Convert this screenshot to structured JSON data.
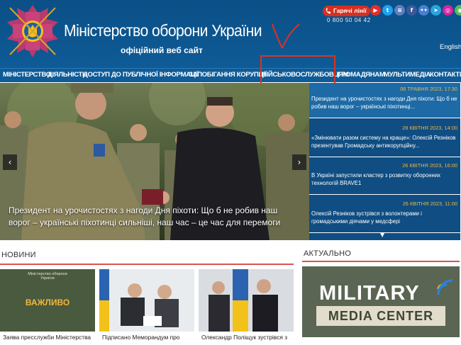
{
  "header": {
    "title": "Міністерство оборони України",
    "subtitle": "офіційний веб сайт",
    "hotline_label": "Гарячі лінії",
    "hotline_number": "0 800 50 04 42",
    "language": "English",
    "socials": [
      {
        "name": "youtube-icon",
        "glyph": "▶",
        "color": "#e52d27"
      },
      {
        "name": "twitter-icon",
        "glyph": "t",
        "color": "#1da1f2"
      },
      {
        "name": "news-icon",
        "glyph": "≡",
        "color": "#5b7fbf"
      },
      {
        "name": "facebook-icon",
        "glyph": "f",
        "color": "#3b5998"
      },
      {
        "name": "flickr-icon",
        "glyph": "••",
        "color": "#4a7fd0"
      },
      {
        "name": "telegram-icon",
        "glyph": "➤",
        "color": "#2aa3dc"
      },
      {
        "name": "instagram-icon",
        "glyph": "◎",
        "color": "#d6249f"
      },
      {
        "name": "rss-icon",
        "glyph": "◉",
        "color": "#59b85c"
      }
    ]
  },
  "nav": {
    "items": [
      {
        "label": "МІНІСТЕРСТВО"
      },
      {
        "label": "ДІЯЛЬНІСТЬ"
      },
      {
        "label": "ДОСТУП ДО ПУБЛІЧНОЇ ІНФОРМАЦІЇ"
      },
      {
        "label": "ЗАПОБІГАННЯ КОРУПЦІЇ"
      },
      {
        "label": "ВІЙСЬКОВОСЛУЖБОВЦЯМ"
      },
      {
        "label": "ГРОМАДЯНАМ"
      },
      {
        "label": "МУЛЬТИМЕДІА"
      },
      {
        "label": "КОНТАКТИ"
      }
    ]
  },
  "hero": {
    "caption": "Президент на урочистостях з нагоди Дня піхоти: Що б не робив наш ворог – українські піхотинці сильніші, наш час – це час для перемоги",
    "prev": "‹",
    "next": "›"
  },
  "news": [
    {
      "date": "06 ТРАВНЯ 2023, 17:30",
      "title": "Президент на урочистостях з нагоди Дня піхоти: Що б не робив наш ворог – українські піхотинці..."
    },
    {
      "date": "28 КВІТНЯ 2023, 14:00",
      "title": "«Змінювати разом систему на краще»: Олексій Резніков презентував Громадську антикорупційну..."
    },
    {
      "date": "26 КВІТНЯ 2023, 16:00",
      "title": "В Україні запустили кластер з розвитку оборонних технологій BRAVE1"
    },
    {
      "date": "26 КВІТНЯ 2023, 11:00",
      "title": "Олексій Резніков зустрівся з волонтерами і громадськими діячами у медсфері"
    }
  ],
  "news_more": "▼",
  "sections": {
    "news_title": "НОВИНИ",
    "actual_title": "АКТУАЛЬНО"
  },
  "cards": [
    {
      "caption": "Заява пресслужби Міністерства",
      "org": "Міністерство оборони України",
      "badge": "ВАЖЛИВО"
    },
    {
      "caption": "Підписано Меморандум про"
    },
    {
      "caption": "Олександр Поліщук зустрівся з"
    }
  ],
  "promo": {
    "title": "MILITARY",
    "subtitle": "MEDIA CENTER"
  },
  "colors": {
    "header_blue": "#0e5b97",
    "accent_red": "#d9534f",
    "date_yellow": "#f3b73a",
    "news_bg": "#0f4d82"
  }
}
